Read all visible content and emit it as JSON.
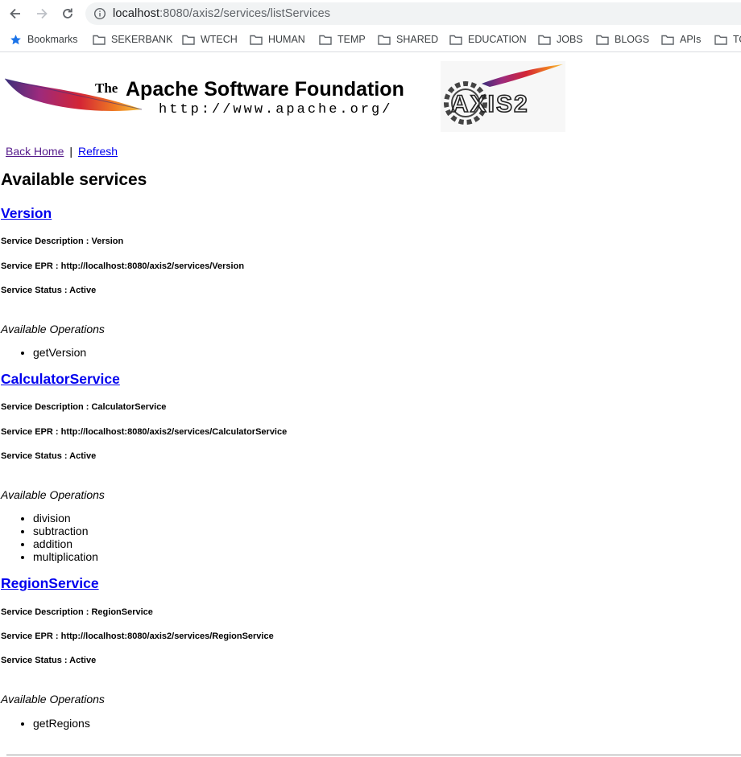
{
  "browser": {
    "url_host": "localhost",
    "url_rest": ":8080/axis2/services/listServices",
    "bookmarks": [
      "Bookmarks",
      "SEKERBANK",
      "WTECH",
      "HUMAN",
      "TEMP",
      "SHARED",
      "EDUCATION",
      "JOBS",
      "BLOGS",
      "APIs",
      "TO"
    ]
  },
  "banner": {
    "the": "The",
    "foundation": "Apache Software Foundation",
    "url": "http://www.apache.org/",
    "logo_text": "AXIS2"
  },
  "nav": {
    "back_home": "Back Home",
    "separator": "|",
    "refresh": "Refresh"
  },
  "page_title": "Available services",
  "services": [
    {
      "name": "Version",
      "description": "Service Description : Version",
      "epr": "Service EPR : http://localhost:8080/axis2/services/Version",
      "status": "Service Status : Active",
      "ops_label": "Available Operations",
      "operations": [
        "getVersion"
      ]
    },
    {
      "name": "CalculatorService",
      "description": "Service Description : CalculatorService",
      "epr": "Service EPR : http://localhost:8080/axis2/services/CalculatorService",
      "status": "Service Status : Active",
      "ops_label": "Available Operations",
      "operations": [
        "division",
        "subtraction",
        "addition",
        "multiplication"
      ]
    },
    {
      "name": "RegionService",
      "description": "Service Description : RegionService",
      "epr": "Service EPR : http://localhost:8080/axis2/services/RegionService",
      "status": "Service Status : Active",
      "ops_label": "Available Operations",
      "operations": [
        "getRegions"
      ]
    }
  ],
  "colors": {
    "link": "#0000ee",
    "visited": "#551a8b",
    "bookmark_star": "#1a73e8"
  }
}
